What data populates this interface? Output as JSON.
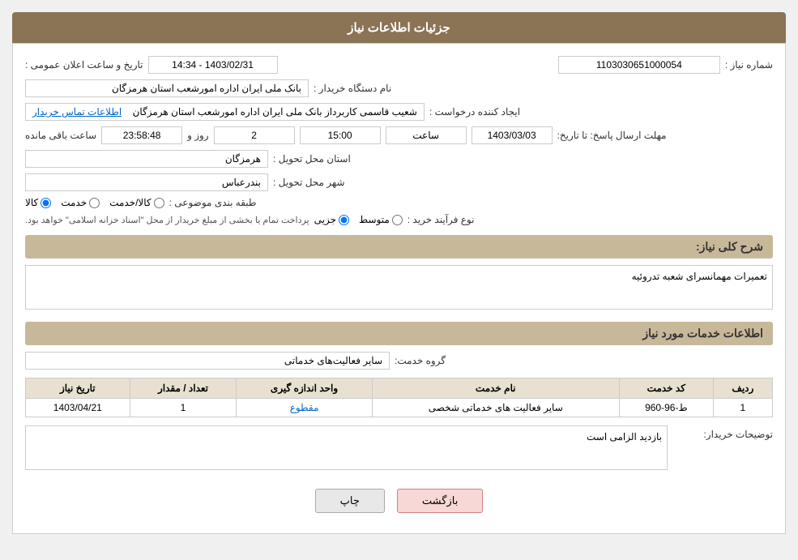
{
  "page": {
    "title": "جزئیات اطلاعات نیاز"
  },
  "sections": {
    "service_info": "اطلاعات خدمات مورد نیاز"
  },
  "fields": {
    "need_number_label": "شماره نیاز :",
    "need_number_value": "1103030651000054",
    "announce_datetime_label": "تاریخ و ساعت اعلان عمومی :",
    "announce_datetime_value": "1403/02/31 - 14:34",
    "buyer_org_label": "نام دستگاه خریدار :",
    "buyer_org_value": "بانک ملی ایران اداره امورشعب استان هرمزگان",
    "creator_label": "ایجاد کننده درخواست :",
    "creator_value": "شعیب قاسمی کاربرداز بانک ملی ایران اداره امورشعب استان هرمزگان",
    "contact_info_link": "اطلاعات تماس خریدار",
    "deadline_label": "مهلت ارسال پاسخ: تا تاریخ:",
    "deadline_date": "1403/03/03",
    "deadline_time_label": "ساعت",
    "deadline_time": "15:00",
    "deadline_days_label": "روز و",
    "deadline_days": "2",
    "deadline_remaining_label": "ساعت باقی مانده",
    "deadline_remaining": "23:58:48",
    "province_label": "استان محل تحویل :",
    "province_value": "هرمزگان",
    "city_label": "شهر محل تحویل :",
    "city_value": "بندرعباس",
    "category_label": "طبقه بندی موضوعی :",
    "category_kala": "کالا",
    "category_khadamat": "خدمت",
    "category_kala_khadamat": "کالا/خدمت",
    "process_label": "نوع فرآیند خرید :",
    "process_jozyi": "جزیی",
    "process_motawaset": "متوسط",
    "process_note": "پرداخت تمام یا بخشی از مبلغ خریدار از محل \"اسناد خزانه اسلامی\" خواهد بود.",
    "need_description_label": "شرح کلی نیاز:",
    "need_description_value": "تعمیرات مهمانسرای شعبه تدروئیه",
    "service_group_label": "گروه خدمت:",
    "service_group_value": "سایر فعالیت‌های خدماتی",
    "table": {
      "headers": [
        "ردیف",
        "کد خدمت",
        "نام خدمت",
        "واحد اندازه گیری",
        "تعداد / مقدار",
        "تاریخ نیاز"
      ],
      "rows": [
        {
          "row": "1",
          "service_code": "ط-96-960",
          "service_name": "سایر فعالیت های خدماتی شخصی",
          "unit": "مقطوع",
          "quantity": "1",
          "date": "1403/04/21"
        }
      ]
    },
    "buyer_notes_label": "توضیحات خریدار:",
    "buyer_notes_value": "بازدید الزامی است"
  },
  "buttons": {
    "print_label": "چاپ",
    "back_label": "بازگشت"
  }
}
